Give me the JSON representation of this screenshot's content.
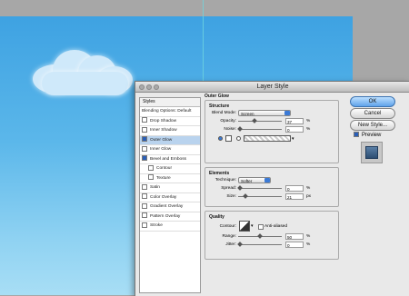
{
  "dialog": {
    "title": "Layer Style"
  },
  "styles_list": {
    "header": "Styles",
    "items": [
      {
        "label": "Blending Options: Default",
        "checkbox": false,
        "checked": false,
        "selected": false,
        "indent": false
      },
      {
        "label": "Drop Shadow",
        "checkbox": true,
        "checked": false,
        "selected": false,
        "indent": false
      },
      {
        "label": "Inner Shadow",
        "checkbox": true,
        "checked": false,
        "selected": false,
        "indent": false
      },
      {
        "label": "Outer Glow",
        "checkbox": true,
        "checked": true,
        "selected": true,
        "indent": false
      },
      {
        "label": "Inner Glow",
        "checkbox": true,
        "checked": false,
        "selected": false,
        "indent": false
      },
      {
        "label": "Bevel and Emboss",
        "checkbox": true,
        "checked": true,
        "selected": false,
        "indent": false
      },
      {
        "label": "Contour",
        "checkbox": true,
        "checked": false,
        "selected": false,
        "indent": true
      },
      {
        "label": "Texture",
        "checkbox": true,
        "checked": false,
        "selected": false,
        "indent": true
      },
      {
        "label": "Satin",
        "checkbox": true,
        "checked": false,
        "selected": false,
        "indent": false
      },
      {
        "label": "Color Overlay",
        "checkbox": true,
        "checked": false,
        "selected": false,
        "indent": false
      },
      {
        "label": "Gradient Overlay",
        "checkbox": true,
        "checked": false,
        "selected": false,
        "indent": false
      },
      {
        "label": "Pattern Overlay",
        "checkbox": true,
        "checked": false,
        "selected": false,
        "indent": false
      },
      {
        "label": "Stroke",
        "checkbox": true,
        "checked": false,
        "selected": false,
        "indent": false
      }
    ]
  },
  "outer_glow": {
    "title": "Outer Glow",
    "structure": {
      "title": "Structure",
      "blend_mode_label": "Blend Mode:",
      "blend_mode_value": "Screen",
      "opacity_label": "Opacity:",
      "opacity_value": "37",
      "opacity_unit": "%",
      "noise_label": "Noise:",
      "noise_value": "0",
      "noise_unit": "%"
    },
    "elements": {
      "title": "Elements",
      "technique_label": "Technique:",
      "technique_value": "Softer",
      "spread_label": "Spread:",
      "spread_value": "0",
      "spread_unit": "%",
      "size_label": "Size:",
      "size_value": "21",
      "size_unit": "px"
    },
    "quality": {
      "title": "Quality",
      "contour_label": "Contour:",
      "anti_aliased_label": "Anti-aliased",
      "range_label": "Range:",
      "range_value": "50",
      "range_unit": "%",
      "jitter_label": "Jitter:",
      "jitter_value": "0",
      "jitter_unit": "%"
    }
  },
  "buttons": {
    "ok": "OK",
    "cancel": "Cancel",
    "new_style": "New Style...",
    "preview": "Preview"
  },
  "colors": {
    "sky": "#4fb0e8",
    "selected_row": "#b9d3ee",
    "accent": "#3b7ad6"
  }
}
